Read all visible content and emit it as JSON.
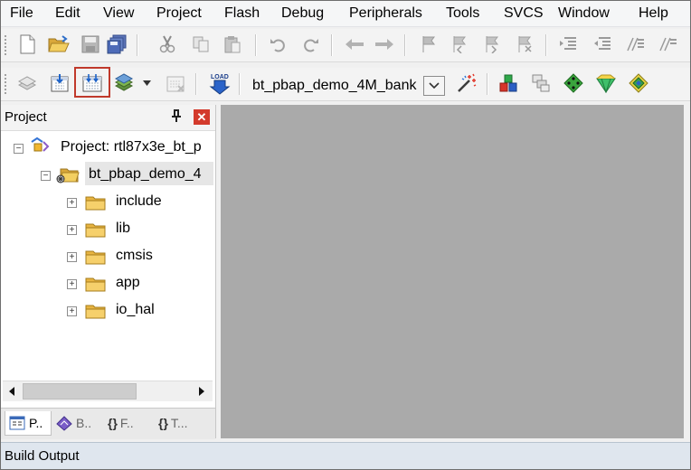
{
  "menu": [
    "File",
    "Edit",
    "View",
    "Project",
    "Flash",
    "Debug",
    "Peripherals",
    "Tools",
    "SVCS",
    "Window",
    "Help"
  ],
  "toolbar2": {
    "target_value": "bt_pbap_demo_4M_bank",
    "load_label": "LOAD"
  },
  "project_panel": {
    "title": "Project",
    "root_label": "Project: rtl87x3e_bt_p",
    "target_label": "bt_pbap_demo_4",
    "groups": [
      "include",
      "lib",
      "cmsis",
      "app",
      "io_hal"
    ],
    "tabs": [
      "P..",
      "B..",
      "F..",
      "T..."
    ],
    "tab_symbols": [
      "{}",
      "{}"
    ]
  },
  "build_output": {
    "label": "Build Output"
  },
  "colors": {
    "highlight_border": "#c0392b",
    "editor_bg": "#aaaaaa",
    "panel_close": "#d33a2c"
  }
}
